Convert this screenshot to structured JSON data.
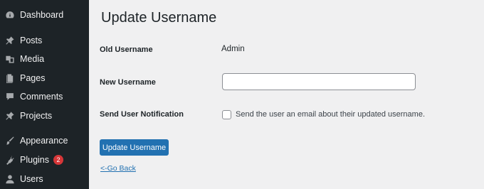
{
  "sidebar": {
    "items": [
      {
        "label": "Dashboard",
        "icon": "dashboard-icon"
      },
      {
        "label": "Posts",
        "icon": "pin-icon"
      },
      {
        "label": "Media",
        "icon": "media-icon"
      },
      {
        "label": "Pages",
        "icon": "pages-icon"
      },
      {
        "label": "Comments",
        "icon": "comment-icon"
      },
      {
        "label": "Projects",
        "icon": "pin-icon"
      },
      {
        "label": "Appearance",
        "icon": "brush-icon"
      },
      {
        "label": "Plugins",
        "icon": "plugin-icon",
        "badge": "2"
      },
      {
        "label": "Users",
        "icon": "user-icon"
      }
    ]
  },
  "main": {
    "title": "Update Username",
    "old_username_label": "Old Username",
    "old_username_value": "Admin",
    "new_username_label": "New Username",
    "new_username_value": "",
    "notification_label": "Send User Notification",
    "notification_text": "Send the user an email about their updated username.",
    "notification_checked": false,
    "submit_label": "Update Username",
    "back_link": "<-Go Back"
  },
  "colors": {
    "sidebar_bg": "#1d2327",
    "page_bg": "#f0f0f1",
    "accent": "#2271b1",
    "badge": "#d63638"
  }
}
